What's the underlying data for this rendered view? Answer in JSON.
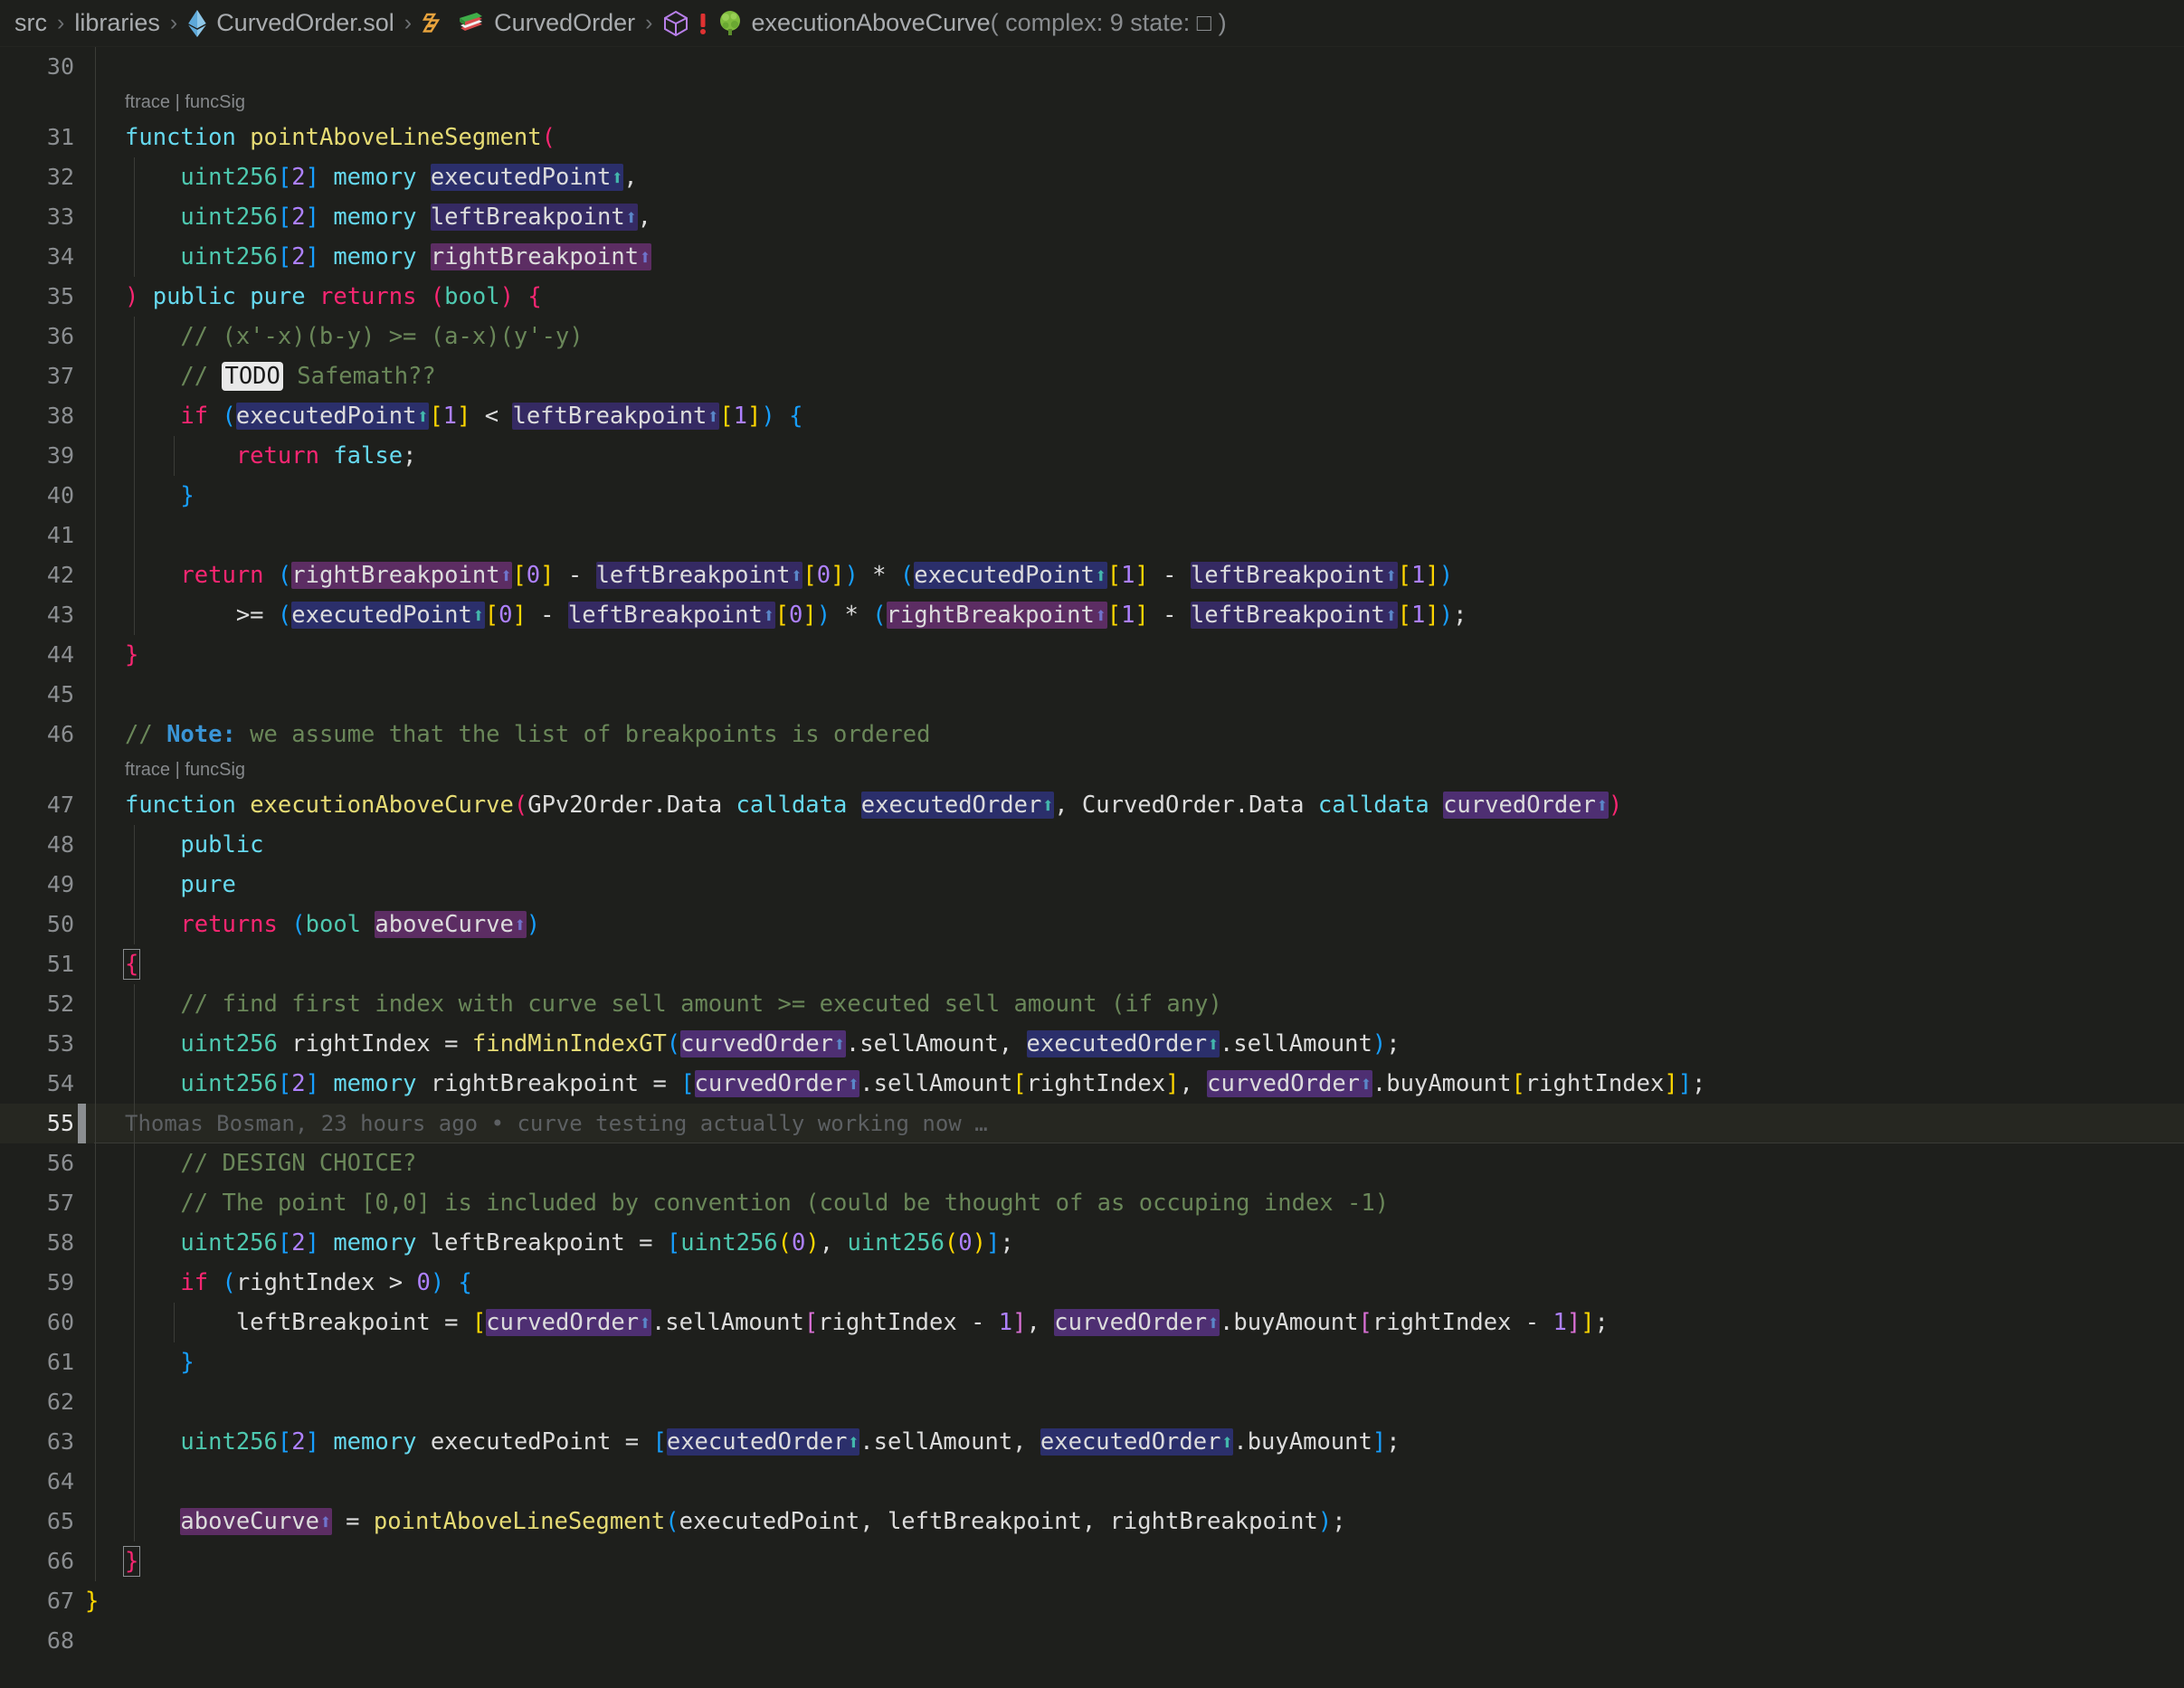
{
  "breadcrumb": {
    "segments": [
      {
        "icon": "none",
        "icon_name": "",
        "label": "src"
      },
      {
        "icon": "none",
        "icon_name": "",
        "label": "libraries"
      },
      {
        "icon": "ethereum",
        "icon_name": "ethereum-file-icon",
        "label": "CurvedOrder.sol"
      },
      {
        "icon": "contract-books",
        "icon_name": "solidity-contract-icon",
        "label": "CurvedOrder"
      },
      {
        "icon": "cube-error",
        "icon_name": "method-symbol-icon",
        "label": "executionAboveCurve",
        "suffix": "(  complex: 9 state: □ )"
      }
    ],
    "separator": "›"
  },
  "editor": {
    "first_line": 30,
    "last_line": 68,
    "current_line": 55,
    "code_lens_label": "ftrace | funcSig",
    "blame": {
      "author": "Thomas Bosman",
      "when": "23 hours ago",
      "bullet": "•",
      "message": "curve testing actually working now …",
      "full": "Thomas Bosman, 23 hours ago • curve testing actually working now …"
    },
    "lines": {
      "30": "",
      "31": "function pointAboveLineSegment(",
      "32": "    uint256[2] memory executedPoint↑,",
      "33": "    uint256[2] memory leftBreakpoint↑,",
      "34": "    uint256[2] memory rightBreakpoint↑",
      "35": ") public pure returns (bool) {",
      "36": "    // (x'-x)(b-y) >= (a-x)(y'-y)",
      "37": "    // TODO Safemath??",
      "38": "    if (executedPoint↑[1] < leftBreakpoint↑[1]) {",
      "39": "        return false;",
      "40": "    }",
      "41": "",
      "42": "    return (rightBreakpoint↑[0] - leftBreakpoint↑[0]) * (executedPoint↑[1] - leftBreakpoint↑[1])",
      "43": "        >= (executedPoint↑[0] - leftBreakpoint↑[0]) * (rightBreakpoint↑[1] - leftBreakpoint↑[1]);",
      "44": "}",
      "45": "",
      "46": "// Note: we assume that the list of breakpoints is ordered",
      "47": "function executionAboveCurve(GPv2Order.Data calldata executedOrder↑, CurvedOrder.Data calldata curvedOrder↑)",
      "48": "    public",
      "49": "    pure",
      "50": "    returns (bool aboveCurve↑)",
      "51": "{",
      "52": "    // find first index with curve sell amount >= executed sell amount (if any)",
      "53": "    uint256 rightIndex = findMinIndexGT(curvedOrder↑.sellAmount, executedOrder↑.sellAmount);",
      "54": "    uint256[2] memory rightBreakpoint = [curvedOrder↑.sellAmount[rightIndex], curvedOrder↑.buyAmount[rightIndex]];",
      "55": "",
      "56": "    // DESIGN CHOICE?",
      "57": "    // The point [0,0] is included by convention (could be thought of as occuping index -1)",
      "58": "    uint256[2] memory leftBreakpoint = [uint256(0), uint256(0)];",
      "59": "    if (rightIndex > 0) {",
      "60": "        leftBreakpoint = [curvedOrder↑.sellAmount[rightIndex - 1], curvedOrder↑.buyAmount[rightIndex - 1]];",
      "61": "    }",
      "62": "",
      "63": "    uint256[2] memory executedPoint = [executedOrder↑.sellAmount, executedOrder↑.buyAmount];",
      "64": "",
      "65": "    aboveCurve↑ = pointAboveLineSegment(executedPoint, leftBreakpoint, rightBreakpoint);",
      "66": "}",
      "67": "}",
      "68": ""
    }
  },
  "colors": {
    "background": "#1e1f1c",
    "current_line": "#262721",
    "gutter_text": "#8b8e91",
    "keyword": "#66d9ef",
    "function": "#e6db74",
    "comment": "#6a8759",
    "number": "#ae81ff",
    "punctuation": "#f92672",
    "highlight_blue": "#2b2f6b",
    "highlight_purple": "#4e2f72",
    "highlight_magenta": "#5c2d63",
    "blame_text": "#5d6063",
    "todo_badge_bg": "#e8e8e8"
  }
}
